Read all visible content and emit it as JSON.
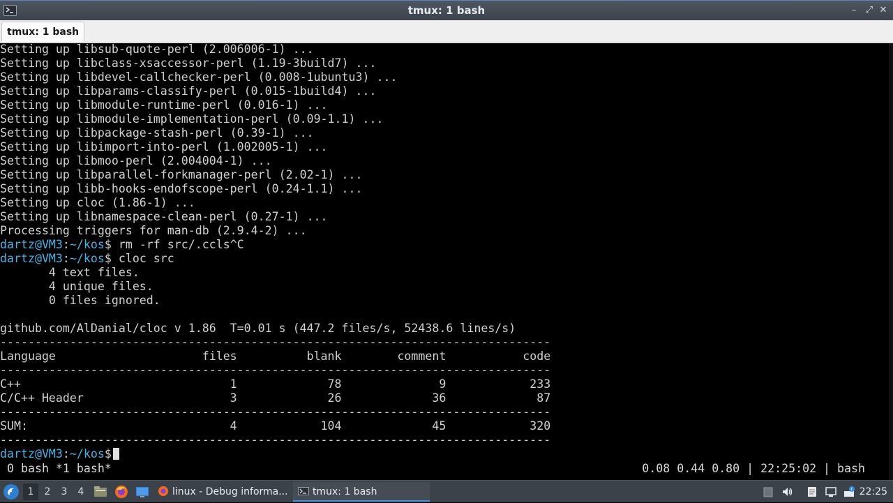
{
  "window": {
    "title": "tmux: 1 bash",
    "tab_label": "tmux: 1 bash"
  },
  "terminal": {
    "lines": [
      "Setting up libsub-quote-perl (2.006006-1) ...",
      "Setting up libclass-xsaccessor-perl (1.19-3build7) ...",
      "Setting up libdevel-callchecker-perl (0.008-1ubuntu3) ...",
      "Setting up libparams-classify-perl (0.015-1build4) ...",
      "Setting up libmodule-runtime-perl (0.016-1) ...",
      "Setting up libmodule-implementation-perl (0.09-1.1) ...",
      "Setting up libpackage-stash-perl (0.39-1) ...",
      "Setting up libimport-into-perl (1.002005-1) ...",
      "Setting up libmoo-perl (2.004004-1) ...",
      "Setting up libparallel-forkmanager-perl (2.02-1) ...",
      "Setting up libb-hooks-endofscope-perl (0.24-1.1) ...",
      "Setting up cloc (1.86-1) ...",
      "Setting up libnamespace-clean-perl (0.27-1) ...",
      "Processing triggers for man-db (2.9.4-2) ..."
    ],
    "prompt_user": "dartz@VM3",
    "prompt_path": "~/kos",
    "commands": [
      "rm -rf src/.ccls^C",
      "cloc src"
    ],
    "cloc_output": [
      "       4 text files.",
      "       4 unique files.",
      "       0 files ignored.",
      "",
      "github.com/AlDanial/cloc v 1.86  T=0.01 s (447.2 files/s, 52438.6 lines/s)",
      "-------------------------------------------------------------------------------",
      "Language                     files          blank        comment           code",
      "-------------------------------------------------------------------------------",
      "C++                              1             78              9            233",
      "C/C++ Header                     3             26             36             87",
      "-------------------------------------------------------------------------------",
      "SUM:                             4            104             45            320",
      "-------------------------------------------------------------------------------"
    ]
  },
  "tmux_status": {
    "left": " 0 bash *1 bash*",
    "right": "0.08 0.44 0.80 | 22:25:02 | bash"
  },
  "taskbar": {
    "workspaces": [
      "1",
      "2",
      "3",
      "4"
    ],
    "tasks": [
      {
        "label": "linux - Debug informa..."
      },
      {
        "label": "tmux: 1 bash"
      }
    ],
    "clock": "22:25"
  },
  "colors": {
    "prompt": "#3fb6e8",
    "accent": "#3a8ee6"
  }
}
